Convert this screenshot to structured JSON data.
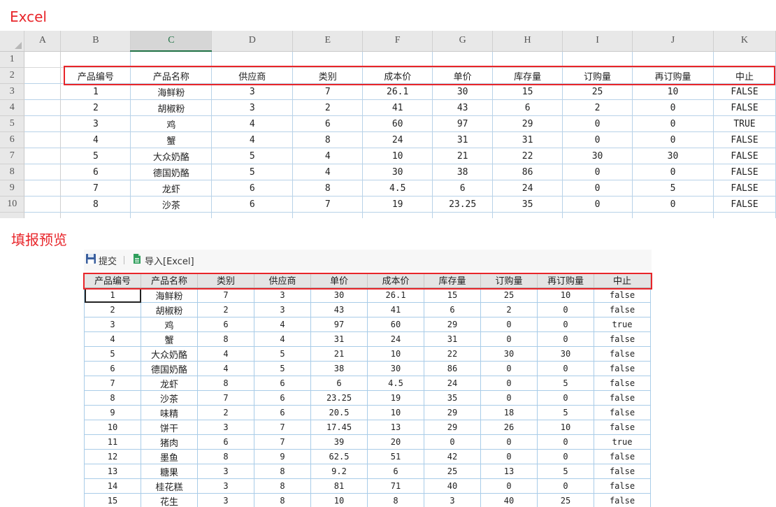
{
  "excel_title": "Excel",
  "preview_title": "填报预览",
  "excel": {
    "columns": [
      "A",
      "B",
      "C",
      "D",
      "E",
      "F",
      "G",
      "H",
      "I",
      "J",
      "K"
    ],
    "selected_column": "C",
    "rows": [
      {
        "num": "1",
        "cells": [
          "",
          "",
          "",
          "",
          "",
          "",
          "",
          "",
          "",
          ""
        ]
      },
      {
        "num": "2",
        "cells": [
          "产品编号",
          "产品名称",
          "供应商",
          "类别",
          "成本价",
          "单价",
          "库存量",
          "订购量",
          "再订购量",
          "中止"
        ]
      },
      {
        "num": "3",
        "cells": [
          "1",
          "海鲜粉",
          "3",
          "7",
          "26.1",
          "30",
          "15",
          "25",
          "10",
          "FALSE"
        ]
      },
      {
        "num": "4",
        "cells": [
          "2",
          "胡椒粉",
          "3",
          "2",
          "41",
          "43",
          "6",
          "2",
          "0",
          "FALSE"
        ]
      },
      {
        "num": "5",
        "cells": [
          "3",
          "鸡",
          "4",
          "6",
          "60",
          "97",
          "29",
          "0",
          "0",
          "TRUE"
        ]
      },
      {
        "num": "6",
        "cells": [
          "4",
          "蟹",
          "4",
          "8",
          "24",
          "31",
          "31",
          "0",
          "0",
          "FALSE"
        ]
      },
      {
        "num": "7",
        "cells": [
          "5",
          "大众奶酪",
          "5",
          "4",
          "10",
          "21",
          "22",
          "30",
          "30",
          "FALSE"
        ]
      },
      {
        "num": "8",
        "cells": [
          "6",
          "德国奶酪",
          "5",
          "4",
          "30",
          "38",
          "86",
          "0",
          "0",
          "FALSE"
        ]
      },
      {
        "num": "9",
        "cells": [
          "7",
          "龙虾",
          "6",
          "8",
          "4.5",
          "6",
          "24",
          "0",
          "5",
          "FALSE"
        ]
      },
      {
        "num": "10",
        "cells": [
          "8",
          "沙茶",
          "6",
          "7",
          "19",
          "23.25",
          "35",
          "0",
          "0",
          "FALSE"
        ]
      }
    ]
  },
  "toolbar": {
    "submit_label": "提交",
    "import_label": "导入[Excel]"
  },
  "preview": {
    "headers": [
      "产品编号",
      "产品名称",
      "类别",
      "供应商",
      "单价",
      "成本价",
      "库存量",
      "订购量",
      "再订购量",
      "中止"
    ],
    "rows": [
      [
        "1",
        "海鲜粉",
        "7",
        "3",
        "30",
        "26.1",
        "15",
        "25",
        "10",
        "false"
      ],
      [
        "2",
        "胡椒粉",
        "2",
        "3",
        "43",
        "41",
        "6",
        "2",
        "0",
        "false"
      ],
      [
        "3",
        "鸡",
        "6",
        "4",
        "97",
        "60",
        "29",
        "0",
        "0",
        "true"
      ],
      [
        "4",
        "蟹",
        "8",
        "4",
        "31",
        "24",
        "31",
        "0",
        "0",
        "false"
      ],
      [
        "5",
        "大众奶酪",
        "4",
        "5",
        "21",
        "10",
        "22",
        "30",
        "30",
        "false"
      ],
      [
        "6",
        "德国奶酪",
        "4",
        "5",
        "38",
        "30",
        "86",
        "0",
        "0",
        "false"
      ],
      [
        "7",
        "龙虾",
        "8",
        "6",
        "6",
        "4.5",
        "24",
        "0",
        "5",
        "false"
      ],
      [
        "8",
        "沙茶",
        "7",
        "6",
        "23.25",
        "19",
        "35",
        "0",
        "0",
        "false"
      ],
      [
        "9",
        "味精",
        "2",
        "6",
        "20.5",
        "10",
        "29",
        "18",
        "5",
        "false"
      ],
      [
        "10",
        "饼干",
        "3",
        "7",
        "17.45",
        "13",
        "29",
        "26",
        "10",
        "false"
      ],
      [
        "11",
        "猪肉",
        "6",
        "7",
        "39",
        "20",
        "0",
        "0",
        "0",
        "true"
      ],
      [
        "12",
        "墨鱼",
        "8",
        "9",
        "62.5",
        "51",
        "42",
        "0",
        "0",
        "false"
      ],
      [
        "13",
        "糖果",
        "3",
        "8",
        "9.2",
        "6",
        "25",
        "13",
        "5",
        "false"
      ],
      [
        "14",
        "桂花糕",
        "3",
        "8",
        "81",
        "71",
        "40",
        "0",
        "0",
        "false"
      ],
      [
        "15",
        "花生",
        "3",
        "8",
        "10",
        "8",
        "3",
        "40",
        "25",
        "false"
      ]
    ]
  }
}
